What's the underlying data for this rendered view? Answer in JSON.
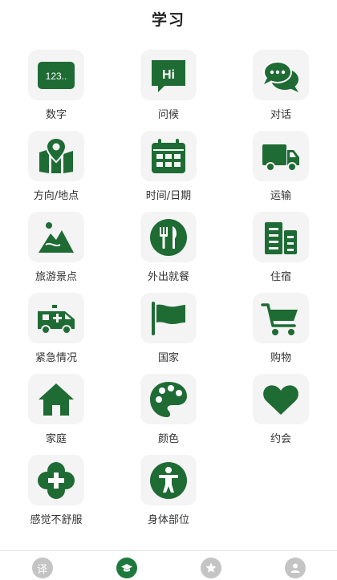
{
  "header": {
    "title": "学习"
  },
  "icon_color": "#1e6b34",
  "categories": [
    {
      "label": "数字",
      "icon": "number-icon",
      "icon_text": "123.."
    },
    {
      "label": "问候",
      "icon": "greeting-bubble-icon",
      "icon_text": "Hi"
    },
    {
      "label": "对话",
      "icon": "chat-bubbles-icon"
    },
    {
      "label": "方向/地点",
      "icon": "map-pin-icon"
    },
    {
      "label": "时间/日期",
      "icon": "calendar-icon"
    },
    {
      "label": "运输",
      "icon": "truck-icon"
    },
    {
      "label": "旅游景点",
      "icon": "landscape-icon"
    },
    {
      "label": "外出就餐",
      "icon": "fork-knife-icon"
    },
    {
      "label": "住宿",
      "icon": "building-icon"
    },
    {
      "label": "紧急情况",
      "icon": "ambulance-icon"
    },
    {
      "label": "国家",
      "icon": "flag-icon"
    },
    {
      "label": "购物",
      "icon": "shopping-cart-icon"
    },
    {
      "label": "家庭",
      "icon": "home-icon"
    },
    {
      "label": "颜色",
      "icon": "palette-icon"
    },
    {
      "label": "约会",
      "icon": "heart-icon"
    },
    {
      "label": "感觉不舒服",
      "icon": "health-cross-icon"
    },
    {
      "label": "身体部位",
      "icon": "body-icon"
    }
  ],
  "tabbar": {
    "active_color": "#1e7a3c",
    "inactive_color": "#c4c4c4",
    "tabs": [
      {
        "name": "translate",
        "text": "译",
        "icon": "translate-icon",
        "active": false
      },
      {
        "name": "learn",
        "icon": "graduation-cap-icon",
        "active": true
      },
      {
        "name": "favorites",
        "icon": "star-icon",
        "active": false
      },
      {
        "name": "profile",
        "icon": "user-icon",
        "active": false
      }
    ]
  }
}
